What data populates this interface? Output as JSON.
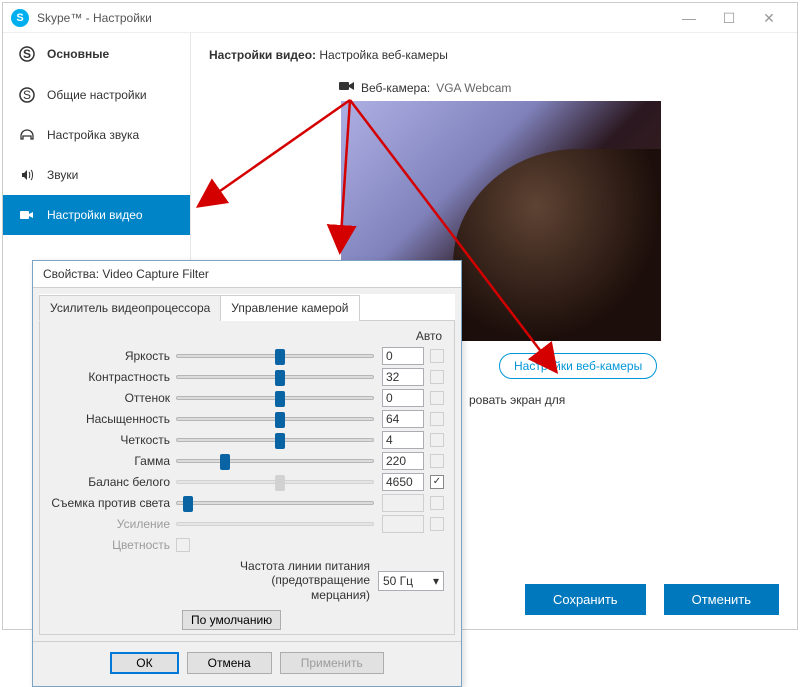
{
  "titlebar": {
    "title": "Skype™ - Настройки"
  },
  "sidebar": {
    "header": "Основные",
    "items": [
      {
        "label": "Общие настройки"
      },
      {
        "label": "Настройка звука"
      },
      {
        "label": "Звуки"
      },
      {
        "label": "Настройки видео"
      }
    ]
  },
  "panel": {
    "title_bold": "Настройки видео:",
    "title_rest": " Настройка веб-камеры",
    "webcam_label": "Веб-камера:",
    "webcam_name": "VGA Webcam",
    "cam_settings_btn": "Настройки веб-камеры",
    "share_text": "ровать экран для"
  },
  "buttons": {
    "save": "Сохранить",
    "cancel": "Отменить"
  },
  "dialog": {
    "title": "Свойства: Video Capture Filter",
    "tabs": [
      "Усилитель видеопроцессора",
      "Управление камерой"
    ],
    "auto_header": "Авто",
    "sliders": [
      {
        "label": "Яркость",
        "value": "0",
        "pos": 50,
        "auto_enabled": false,
        "checked": false,
        "enabled": true
      },
      {
        "label": "Контрастность",
        "value": "32",
        "pos": 50,
        "auto_enabled": false,
        "checked": false,
        "enabled": true
      },
      {
        "label": "Оттенок",
        "value": "0",
        "pos": 50,
        "auto_enabled": false,
        "checked": false,
        "enabled": true
      },
      {
        "label": "Насыщенность",
        "value": "64",
        "pos": 50,
        "auto_enabled": false,
        "checked": false,
        "enabled": true
      },
      {
        "label": "Четкость",
        "value": "4",
        "pos": 50,
        "auto_enabled": false,
        "checked": false,
        "enabled": true
      },
      {
        "label": "Гамма",
        "value": "220",
        "pos": 22,
        "auto_enabled": false,
        "checked": false,
        "enabled": true
      },
      {
        "label": "Баланс белого",
        "value": "4650",
        "pos": 50,
        "auto_enabled": true,
        "checked": true,
        "enabled": true,
        "track_disabled": true
      },
      {
        "label": "Съемка против света",
        "value": "",
        "pos": 3,
        "auto_enabled": false,
        "checked": false,
        "enabled": true,
        "no_value": true
      },
      {
        "label": "Усиление",
        "value": "",
        "pos": 0,
        "auto_enabled": false,
        "checked": false,
        "enabled": false,
        "no_value": true
      },
      {
        "label": "Цветность",
        "value": "",
        "pos": 0,
        "auto_enabled": false,
        "checked": false,
        "enabled": false,
        "checkbox_only": true
      }
    ],
    "freq_label": "Частота линии питания (предотвращение мерцания)",
    "freq_value": "50 Гц",
    "default_btn": "По умолчанию",
    "ok": "ОК",
    "cancel": "Отмена",
    "apply": "Применить"
  }
}
